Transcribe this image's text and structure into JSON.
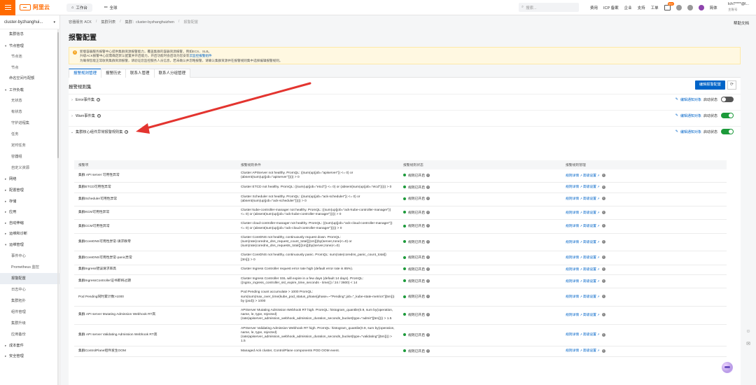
{
  "topbar": {
    "logo_text": "阿里云",
    "workbench_label": "工作台",
    "region_label": "全球",
    "search_placeholder": "搜索...",
    "links": [
      "费用",
      "ICP 备案",
      "企业",
      "支持",
      "工单"
    ],
    "notification_count": "99+",
    "lang_label": "简体",
    "user_name": "lch7****@l...",
    "user_sub": "主账号"
  },
  "sidebar": {
    "cluster_name": "cluster-byzhanghui...",
    "items": [
      {
        "type": "item",
        "label": "集群信息"
      },
      {
        "type": "group",
        "label": "节点管理",
        "open": true
      },
      {
        "type": "sub",
        "label": "节点池"
      },
      {
        "type": "sub",
        "label": "节点"
      },
      {
        "type": "item",
        "label": "命名空间与配额"
      },
      {
        "type": "group",
        "label": "工作负载",
        "open": true
      },
      {
        "type": "sub",
        "label": "无状态"
      },
      {
        "type": "sub",
        "label": "有状态"
      },
      {
        "type": "sub",
        "label": "守护进程集"
      },
      {
        "type": "sub",
        "label": "任务"
      },
      {
        "type": "sub",
        "label": "定时任务"
      },
      {
        "type": "sub",
        "label": "容器组"
      },
      {
        "type": "sub",
        "label": "自定义资源"
      },
      {
        "type": "group",
        "label": "网络",
        "open": false
      },
      {
        "type": "group",
        "label": "配置管理",
        "open": false
      },
      {
        "type": "group",
        "label": "存储",
        "open": false
      },
      {
        "type": "group",
        "label": "应用",
        "open": false
      },
      {
        "type": "group",
        "label": "自动伸缩",
        "open": false
      },
      {
        "type": "group",
        "label": "运维和诊断",
        "open": false
      },
      {
        "type": "group",
        "label": "运维管理",
        "open": true
      },
      {
        "type": "sub",
        "label": "事件中心"
      },
      {
        "type": "sub",
        "label": "Prometheus 监控"
      },
      {
        "type": "sub",
        "label": "报警配置",
        "active": true
      },
      {
        "type": "sub",
        "label": "日志中心"
      },
      {
        "type": "sub",
        "label": "集群拓扑"
      },
      {
        "type": "sub",
        "label": "组件管理"
      },
      {
        "type": "sub",
        "label": "集群升级"
      },
      {
        "type": "sub",
        "label": "应用备份"
      },
      {
        "type": "group",
        "label": "成本套件",
        "open": false
      },
      {
        "type": "group",
        "label": "安全管理",
        "open": false
      }
    ]
  },
  "main": {
    "breadcrumb": [
      "容器服务 ACK",
      "集群列表",
      "集群：cluster-byzhanghuizhen",
      "报警配置"
    ],
    "help_doc": "帮助文档",
    "title": "报警配置",
    "notice_lines": [
      "新版容器服务报警中心提供集群资源报警能力，覆盖集群的容器资源报警，例如ECS、SLB。",
      "升级ACK报警中心前需确定默认配置并开启能力。开启功能时会启动为您安装",
      "为确保您能正常收到集群资源报警，请验证您监控服务人员信息，若未确认并忽略报警，请确认集群资源并在报警规则集中选择编辑报警规则。"
    ],
    "notice_link": "云监控报警组件",
    "tabs": [
      "报警规则管理",
      "报警历史",
      "联系人管理",
      "联系人分组管理"
    ],
    "section_title": "报警规则集",
    "edit_button": "编辑报警配置",
    "rule_sets": [
      {
        "name": "Error事件集",
        "expanded": false,
        "switch_on": false
      },
      {
        "name": "Warn事件集",
        "expanded": false,
        "switch_on": true
      },
      {
        "name": "集群核心组件异常报警规则集",
        "expanded": true,
        "switch_on": true
      }
    ],
    "set_edit_link": "编辑通知对象",
    "set_state_label": "启动状态",
    "table_headers": [
      "报警项",
      "报警规则条件",
      "报警规则状态",
      "报警规则管理"
    ],
    "state_label": "规则已开启",
    "manage_links": [
      "规则详情",
      "高级设置"
    ],
    "rows": [
      {
        "name": "集群 API server 可用性异常",
        "cond": "Cluster APIServer not healthy. PromQL: ((sum(up{job=\"apiserver\"}) <= 0) or (absent(sum(up{job=\"apiserver\"})))) > 0"
      },
      {
        "name": "集群ETCD可用性异常",
        "cond": "Cluster ETCD not healthy. PromQL: ((sum(up{job=\"etcd\"}) <= 0) or (absent(sum(up{job=\"etcd\"})))) > 0"
      },
      {
        "name": "集群Scheduler可用性异常",
        "cond": "Cluster Scheduler not healthy. PromQL: ((sum(up{job=\"ack-scheduler\"}) <= 0) or (absent(sum(up{job=\"ack-scheduler\"})))) > 0"
      },
      {
        "name": "集群KCM可用性异常",
        "cond": "Cluster kube-controller-manager not healthy. PromQL: ((sum(up{job=\"ack-kube-controller-manager\"}) <= 0) or (absent(sum(up{job=\"ack-kube-controller-manager\"})))) > 0"
      },
      {
        "name": "集群CCM可用性异常",
        "cond": "Cluster cloud-controller-manager not healthy. PromQL: ((sum(up{job=\"ack-cloud-controller-manager\"}) <= 0) or (absent(sum(up{job=\"ack-cloud-controller-manager\"})))) > 0"
      },
      {
        "name": "集群CoreDNS可用性异常-请求跌零",
        "cond": "Cluster CoreDNS not healthy, continuously request down. PromQL: (sum(rate(coredns_dns_request_count_total{}[1m]))by(server,zone)<=0) or (sum(rate(coredns_dns_requests_total{}[1m]))by(server,zone)<=0)"
      },
      {
        "name": "集群CoreDNS可用性异常-panic异常",
        "cond": "Cluster CoreDNS not healthy, continuously panic. PromQL: sum(rate(coredns_panic_count_total{}[3m])) > 0"
      },
      {
        "name": "集群Ingress错误请求率高",
        "cond": "Cluster Ingress Controller request error rate high (default error rate is 85%)."
      },
      {
        "name": "集群IngressController证书即将过期",
        "cond": "Cluster Ingress Controller SSL will expire in a few days (default 14 days). PromQL: ((nginx_ingress_controller_ssl_expire_time_seconds - time()) / 24 / 3600) < 14"
      },
      {
        "name": "Pod Pending同时累计数>1000",
        "cond": "Pod Pending count accumulate > 1000 PromQL: sum(sum(max_over_time(kube_pod_status_phase{phase=~\"Pending\",job=\"_kube-state-metrics\"}[5m])) by (pod)) > 1000"
      },
      {
        "name": "集群 API server Mutating Admission Webhook RT高",
        "cond": "APIServer Mutating Admission Webhook RT high. PromQL: histogram_quantile(0.9, sum by(operation, name, le, type, rejected) (rate(apiserver_admission_webhook_admission_duration_seconds_bucket{type=\"admit\"}[5m]))) > 1.5"
      },
      {
        "name": "集群 API server Validating Admission Webhook RT高",
        "cond": "APIServer Validating Admission Webhook RT high. PromQL: histogram_quantile(0.9, sum by(operation, name, le, type, rejected) (rate(apiserver_admission_webhook_admission_duration_seconds_bucket{type=\"validating\"}[5m]))) > 1.5"
      },
      {
        "name": "集群ControlPlane组件发生OOM",
        "cond": "Managed Ack cluster, ControlPlane components POD OOM event."
      }
    ]
  },
  "colors": {
    "brand": "#ff6a00",
    "primary": "#0064c8",
    "success": "#1c9a3a",
    "annotation_arrow": "#e3342f"
  }
}
